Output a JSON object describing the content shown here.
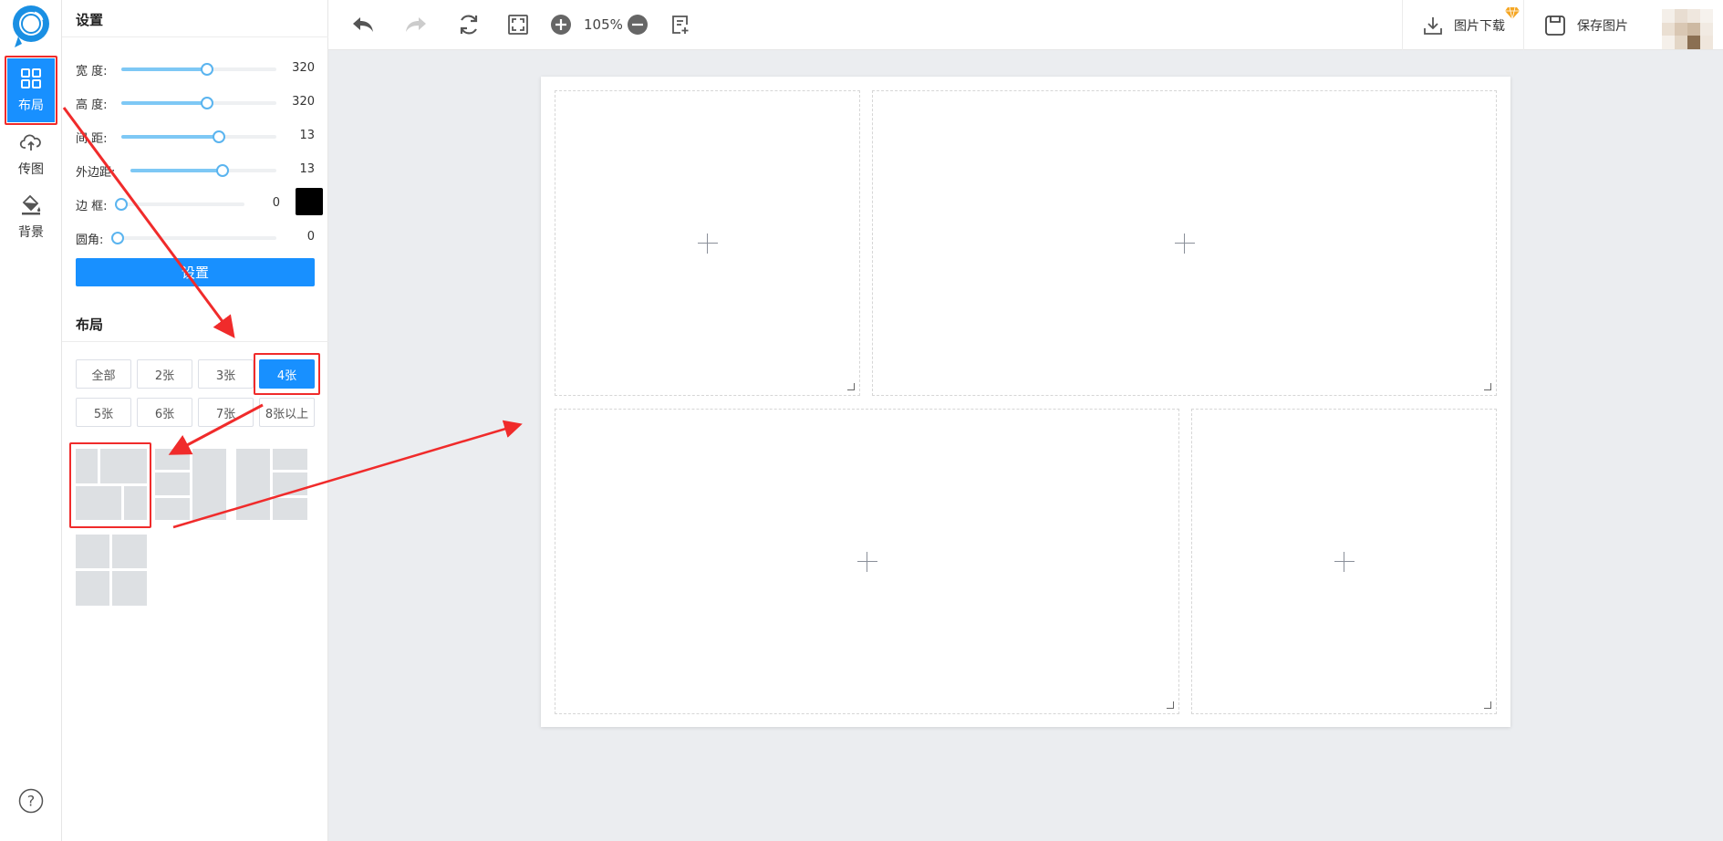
{
  "rail": {
    "items": [
      {
        "label": "布局",
        "icon": "grid-icon"
      },
      {
        "label": "传图",
        "icon": "cloud-upload-icon"
      },
      {
        "label": "背景",
        "icon": "paint-bucket-icon"
      }
    ]
  },
  "settings": {
    "title": "设置",
    "rows": [
      {
        "label": "宽 度:",
        "value": "320",
        "level": 0.55
      },
      {
        "label": "高 度:",
        "value": "320",
        "level": 0.55
      },
      {
        "label": "间 距:",
        "value": "13",
        "level": 0.63
      },
      {
        "label": "外边距:",
        "value": "13",
        "level": 0.63
      },
      {
        "label": "边 框:",
        "value": "0",
        "level": 0
      },
      {
        "label": "圆角:",
        "value": "0",
        "level": 0
      }
    ],
    "border_color": "#000000",
    "apply_label": "设置"
  },
  "layout": {
    "title": "布局",
    "tabs": [
      "全部",
      "2张",
      "3张",
      "4张",
      "5张",
      "6张",
      "7张",
      "8张以上"
    ],
    "active_tab": "4张"
  },
  "toolbar": {
    "zoom": "105%",
    "download_label": "图片下载",
    "save_label": "保存图片"
  },
  "colors": {
    "accent": "#1890ff",
    "highlight": "#f02b2b",
    "slider_fill": "#7ec8f5"
  }
}
